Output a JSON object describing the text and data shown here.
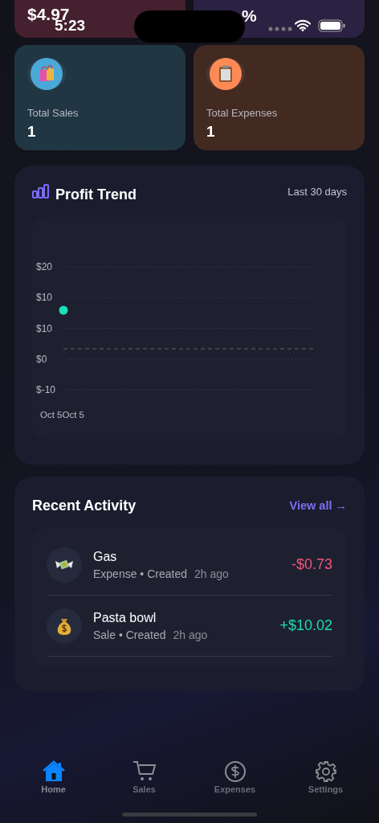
{
  "status_bar": {
    "time": "5:23"
  },
  "summary_cards": [
    {
      "value": "$4.97",
      "color": "#45202f"
    },
    {
      "value": "%",
      "color": "#2b2142"
    }
  ],
  "stats": [
    {
      "kind": "sales",
      "label": "Total Sales",
      "value": "1"
    },
    {
      "kind": "expenses",
      "label": "Total Expenses",
      "value": "1"
    }
  ],
  "profit_trend": {
    "title": "Profit Trend",
    "range": "Last 30 days",
    "chart": {
      "y_labels": [
        "$20",
        "$10",
        "$10",
        "$0",
        "$-10"
      ],
      "x_labels": [
        "Oct 5",
        "Oct 5"
      ]
    }
  },
  "recent_activity": {
    "title": "Recent Activity",
    "link": "View all →",
    "items": [
      {
        "kind": "expense",
        "name": "Gas",
        "meta": "Expense • Created",
        "time": "2h ago",
        "amount": "-$0.73"
      },
      {
        "kind": "sale",
        "name": "Pasta bowl",
        "meta": "Sale • Created",
        "time": "2h ago",
        "amount": "+$10.02"
      }
    ]
  },
  "tab_bar": [
    {
      "kind": "home",
      "label": "Home",
      "selected": true
    },
    {
      "kind": "cart",
      "label": "Sales",
      "selected": false
    },
    {
      "kind": "dollar",
      "label": "Expenses",
      "selected": false
    },
    {
      "kind": "gear",
      "label": "Settings",
      "selected": false
    }
  ]
}
